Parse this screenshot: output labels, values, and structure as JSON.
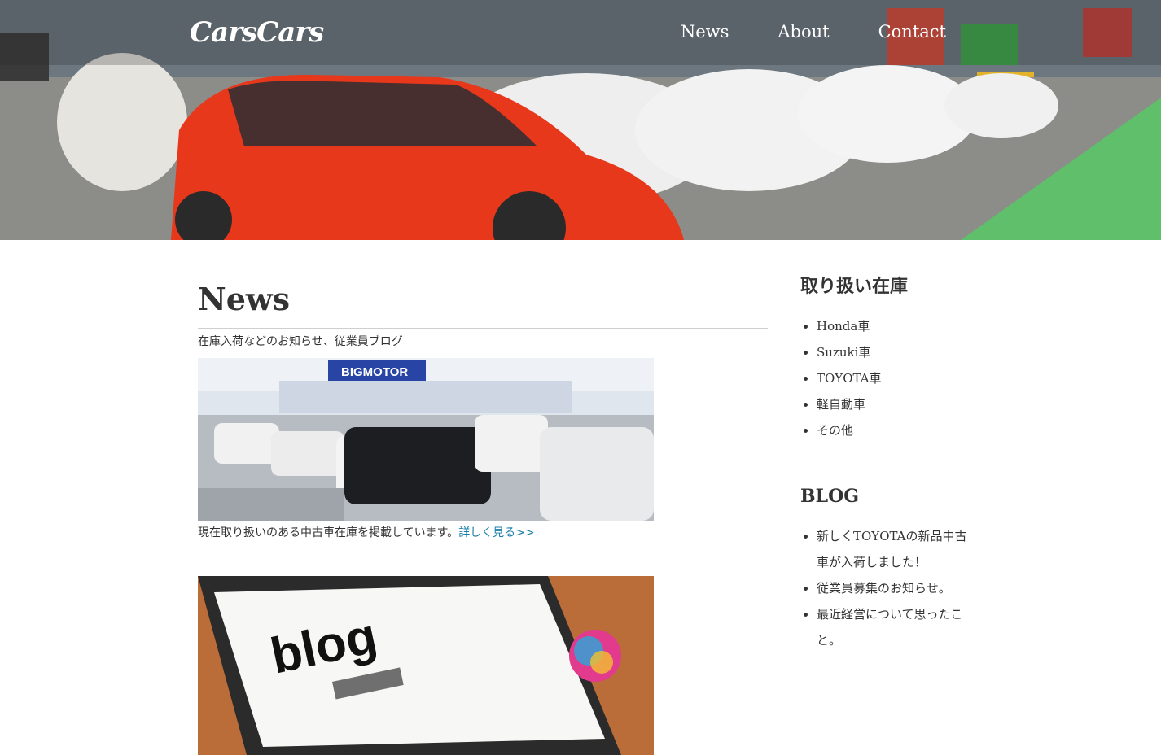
{
  "header": {
    "logo": "CarsCars",
    "nav": [
      {
        "label": "News"
      },
      {
        "label": "About"
      },
      {
        "label": "Contact"
      }
    ]
  },
  "main": {
    "title": "News",
    "subtitle": "在庫入荷などのお知らせ、従業員ブログ",
    "posts": [
      {
        "caption": "現在取り扱いのある中古車在庫を掲載しています。",
        "link": "詳しく見る>>",
        "image_text": "BIGMOTOR"
      },
      {
        "caption": "",
        "link": "",
        "image_text": "blog"
      }
    ]
  },
  "sidebar": {
    "stock_title": "取り扱い在庫",
    "stock_items": [
      "Honda車",
      "Suzuki車",
      "TOYOTA車",
      "軽自動車",
      "その他"
    ],
    "blog_title": "BLOG",
    "blog_items": [
      "新しくTOYOTAの新品中古車が入荷しました！",
      "従業員募集のお知らせ。",
      "最近経営について思ったこと。"
    ]
  },
  "colors": {
    "link": "#1a7fa8",
    "text": "#333333",
    "accent_red": "#e8381c"
  }
}
